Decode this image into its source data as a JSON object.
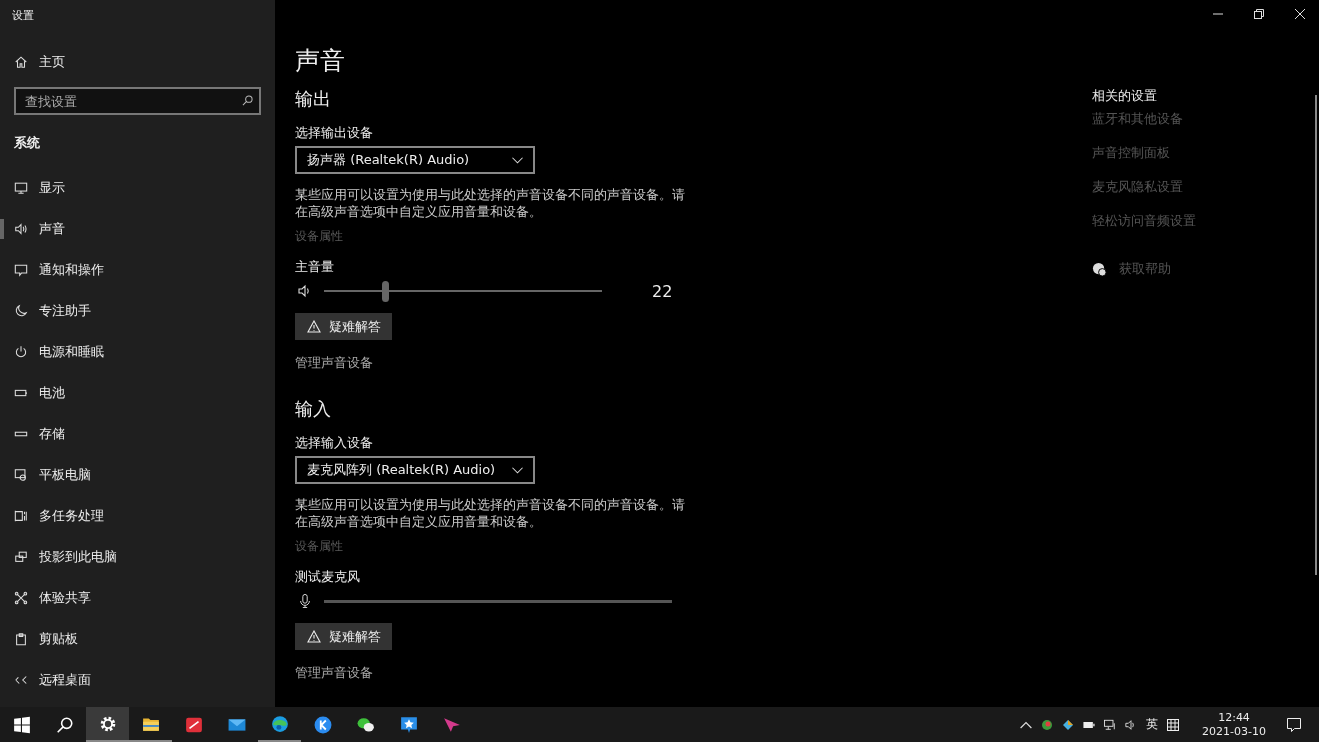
{
  "window": {
    "title": "设置"
  },
  "sidebar": {
    "home": {
      "label": "主页",
      "kind": "home"
    },
    "search": {
      "placeholder": "查找设置"
    },
    "section": "系统",
    "items": [
      {
        "label": "显示",
        "kind": "display",
        "selected": false
      },
      {
        "label": "声音",
        "kind": "sound",
        "selected": true
      },
      {
        "label": "通知和操作",
        "kind": "notification",
        "selected": false
      },
      {
        "label": "专注助手",
        "kind": "moon",
        "selected": false
      },
      {
        "label": "电源和睡眠",
        "kind": "power",
        "selected": false
      },
      {
        "label": "电池",
        "kind": "battery",
        "selected": false
      },
      {
        "label": "存储",
        "kind": "storage",
        "selected": false
      },
      {
        "label": "平板电脑",
        "kind": "tablet",
        "selected": false
      },
      {
        "label": "多任务处理",
        "kind": "multitask",
        "selected": false
      },
      {
        "label": "投影到此电脑",
        "kind": "project",
        "selected": false
      },
      {
        "label": "体验共享",
        "kind": "share",
        "selected": false
      },
      {
        "label": "剪贴板",
        "kind": "clipboard",
        "selected": false
      },
      {
        "label": "远程桌面",
        "kind": "remote",
        "selected": false
      }
    ]
  },
  "page": {
    "title": "声音",
    "sections": [
      {
        "heading": "输出",
        "device_label": "选择输出设备",
        "device": "扬声器 (Realtek(R) Audio)",
        "note": "某些应用可以设置为使用与此处选择的声音设备不同的声音设备。请在高级声音选项中自定义应用音量和设备。",
        "properties_link": "设备属性",
        "meter": {
          "kind": "slider",
          "label": "主音量",
          "level": 0.22,
          "reading": "22"
        },
        "troubleshoot": "疑难解答",
        "manage_link": "管理声音设备"
      },
      {
        "heading": "输入",
        "device_label": "选择输入设备",
        "device": "麦克风阵列 (Realtek(R) Audio)",
        "note": "某些应用可以设置为使用与此处选择的声音设备不同的声音设备。请在高级声音选项中自定义应用音量和设备。",
        "properties_link": "设备属性",
        "meter": {
          "kind": "mic",
          "label": "测试麦克风",
          "level": 0
        },
        "troubleshoot": "疑难解答",
        "manage_link": "管理声音设备"
      }
    ]
  },
  "related": {
    "heading": "相关的设置",
    "links": [
      "蓝牙和其他设备",
      "声音控制面板",
      "麦克风隐私设置",
      "轻松访问音频设置"
    ],
    "help": "获取帮助"
  },
  "taskbar": {
    "apps": [
      {
        "kind": "start",
        "running": false
      },
      {
        "kind": "search",
        "running": false
      },
      {
        "kind": "settings",
        "running": true
      },
      {
        "kind": "explorer",
        "running": true
      },
      {
        "kind": "red",
        "running": false
      },
      {
        "kind": "mail",
        "running": false
      },
      {
        "kind": "edge",
        "running": true
      },
      {
        "kind": "kapp",
        "running": false
      },
      {
        "kind": "wechat",
        "running": false
      },
      {
        "kind": "star",
        "running": false
      },
      {
        "kind": "arrow",
        "running": false
      }
    ],
    "ime": "英",
    "time": "12:44",
    "date": "2021-03-10"
  }
}
